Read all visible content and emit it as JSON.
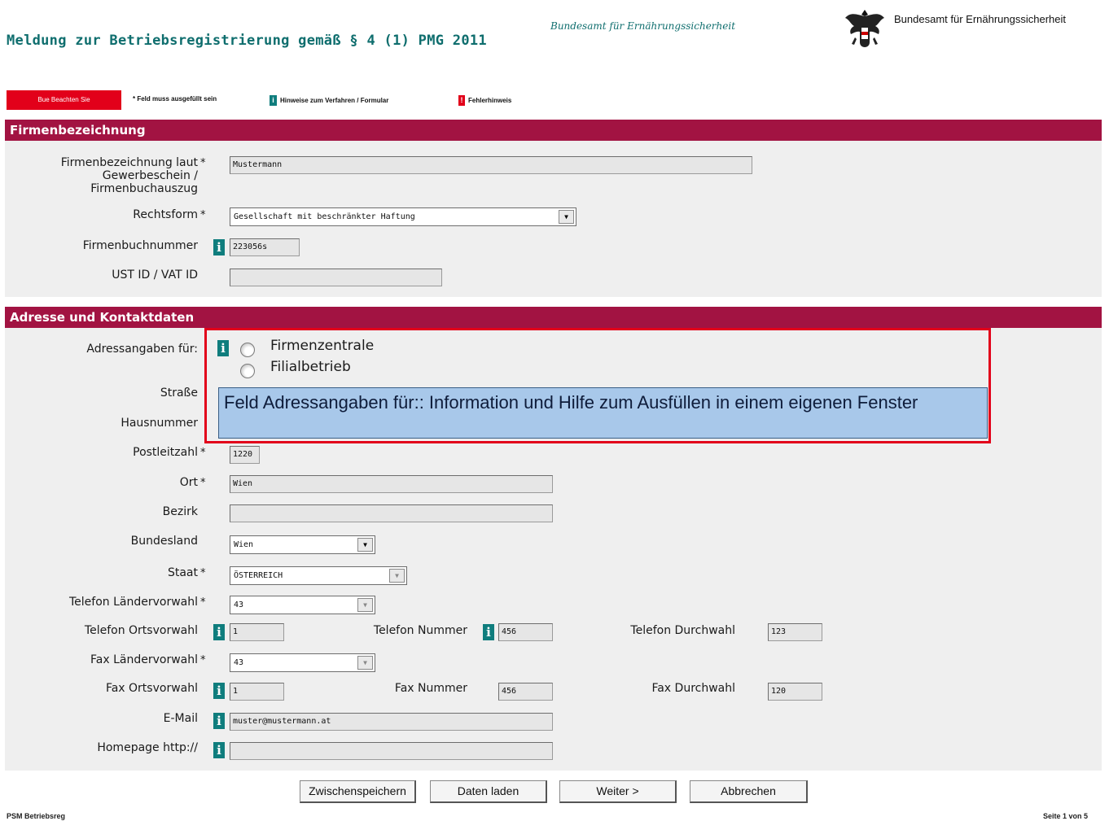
{
  "header": {
    "title": "Meldung zur Betriebsregistrierung gemäß § 4 (1) PMG 2011",
    "agency_script": "Bundesamt für Ernährungssicherheit",
    "agency_name": "Bundesamt für Ernährungssicherheit",
    "logo_icon": "austrian-eagle-icon"
  },
  "legend": {
    "red_label": "Bue Beachten Sie",
    "required_note": "* Feld muss ausgefüllt sein",
    "info_note": "Hinweise zum Verfahren / Formular",
    "error_note": "Fehlerhinweis",
    "info_glyph": "i",
    "error_glyph": "!"
  },
  "section_company": {
    "heading": "Firmenbezeichnung",
    "name_label": "Firmenbezeichnung laut Gewerbeschein / Firmenbuchauszug",
    "name_value": "Mustermann",
    "legal_form_label": "Rechtsform",
    "legal_form_value": "Gesellschaft mit beschränkter Haftung",
    "register_label": "Firmenbuchnummer",
    "register_value": "223056s",
    "vat_label": "UST ID / VAT ID",
    "vat_value": ""
  },
  "section_address": {
    "heading": "Adresse und Kontaktdaten",
    "address_for_label": "Adressangaben für:",
    "option_1": "Firmenzentrale",
    "option_2": "Filialbetrieb",
    "tooltip": "Feld Adressangaben für:: Information und Hilfe zum Ausfüllen in einem eigenen Fenster",
    "street_label": "Straße",
    "house_label": "Hausnummer",
    "zip_label": "Postleitzahl",
    "zip_value": "1220",
    "city_label": "Ort",
    "city_value": "Wien",
    "district_label": "Bezirk",
    "district_value": "",
    "state_label": "Bundesland",
    "state_value": "Wien",
    "country_label": "Staat",
    "country_value": "ÖSTERREICH",
    "phone_cc_label": "Telefon Ländervorwahl",
    "phone_cc_value": "43",
    "phone_area_label": "Telefon Ortsvorwahl",
    "phone_area_value": "1",
    "phone_number_label": "Telefon Nummer",
    "phone_number_value": "456",
    "phone_ext_label": "Telefon Durchwahl",
    "phone_ext_value": "123",
    "fax_cc_label": "Fax Ländervorwahl",
    "fax_cc_value": "43",
    "fax_area_label": "Fax Ortsvorwahl",
    "fax_area_value": "1",
    "fax_number_label": "Fax Nummer",
    "fax_number_value": "456",
    "fax_ext_label": "Fax Durchwahl",
    "fax_ext_value": "120",
    "email_label": "E-Mail",
    "email_value": "muster@mustermann.at",
    "homepage_label": "Homepage http://",
    "homepage_value": ""
  },
  "buttons": {
    "save": "Zwischenspeichern",
    "load": "Daten laden",
    "next": "Weiter >",
    "cancel": "Abbrechen"
  },
  "footer": {
    "left": "PSM Betriebsreg",
    "right": "Seite 1 von 5"
  },
  "colors": {
    "section_header": "#a21342",
    "info_icon": "#0f7d7d",
    "required_red": "#e2001a",
    "tooltip_bg": "#a8c8ea",
    "title_teal": "#0f6e6e"
  }
}
